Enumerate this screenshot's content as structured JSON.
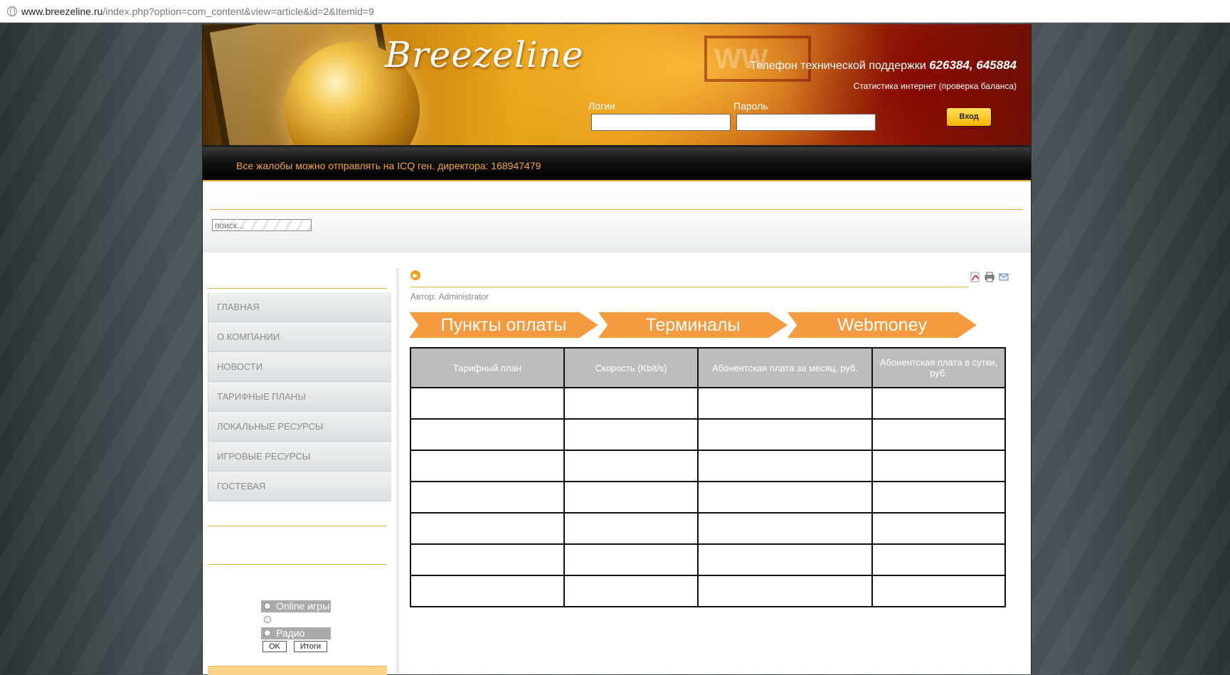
{
  "browser": {
    "url_host": "www.breezeline.ru",
    "url_path": "/index.php?option=com_content&view=article&id=2&Itemid=9"
  },
  "header": {
    "logo": "Breezeline",
    "watermark": "WW",
    "support_label": "Телефон технической поддержки",
    "support_phones": "626384, 645884",
    "stats_link": "Статистика интернет (проверка баланса)",
    "login_label": "Логин",
    "password_label": "Пароль",
    "login_button": "Вход"
  },
  "notice": "Все жалобы можно отправлять на ICQ ген. директора: 168947479",
  "search": {
    "title": "поиск",
    "placeholder": "поиск..."
  },
  "menu": [
    "ГЛАВНАЯ",
    "О КОМПАНИИ",
    "НОВОСТИ",
    "ТАРИФНЫЕ ПЛАНЫ",
    "ЛОКАЛЬНЫЕ РЕСУРСЫ",
    "ИГРОВЫЕ РЕСУРСЫ",
    "ГОСТЕВАЯ"
  ],
  "poll": {
    "options": [
      "Online игры",
      "",
      "Радио"
    ],
    "ok": "OK",
    "results": "Итоги"
  },
  "article": {
    "author": "Автор: Administrator",
    "tabs": [
      "Пункты оплаты",
      "Терминалы",
      "Webmoney"
    ],
    "table_headers": [
      "Тарифный план",
      "Скорость (Kbit/s)",
      "Абонентская плата за месяц, руб.",
      "Абонентская плата в сутки, руб."
    ],
    "empty_rows": 7
  },
  "icons": [
    "pdf-icon",
    "print-icon",
    "email-icon",
    "arrow-circle-icon"
  ],
  "colors": {
    "accent_orange": "#f59a3e",
    "notice_text": "#f5a33a",
    "menu_text": "#8c8c8c"
  }
}
